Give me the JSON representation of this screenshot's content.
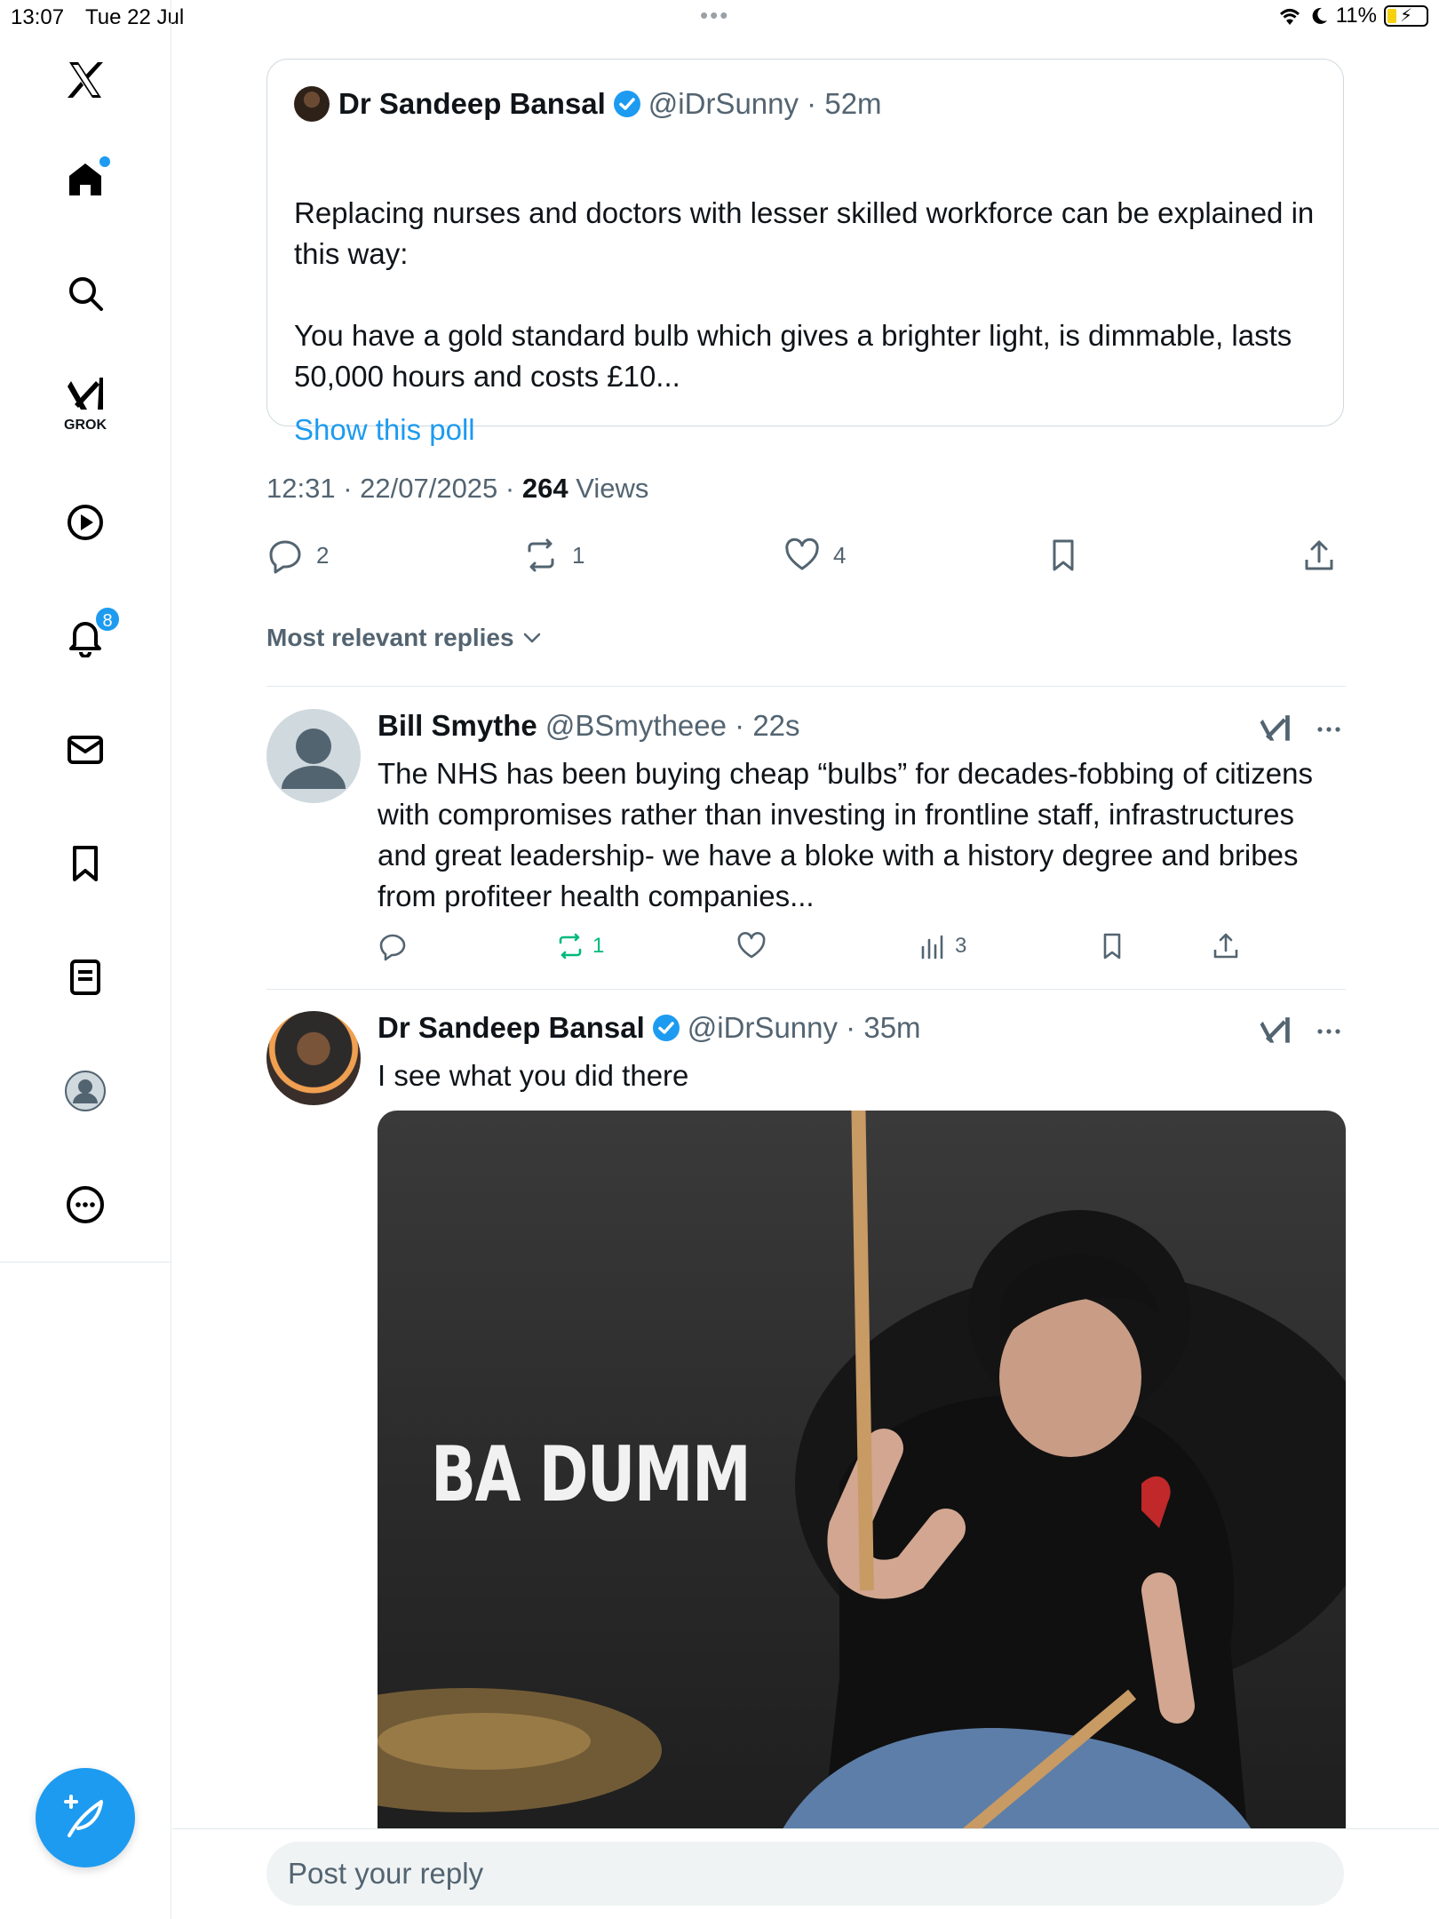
{
  "status": {
    "time": "13:07",
    "date": "Tue 22 Jul",
    "battery": "11%"
  },
  "nav": {
    "grok_label": "GROK",
    "notifications_count": "8"
  },
  "quoted": {
    "name": "Dr Sandeep Bansal",
    "handle": "@iDrSunny",
    "time": "52m",
    "para1": "Replacing nurses and doctors with lesser skilled workforce can be explained in this way:",
    "para2": "You have a gold standard bulb which gives a brighter light, is dimmable, lasts 50,000 hours and costs £10...",
    "link": "Show this poll"
  },
  "meta": {
    "time": "12:31",
    "date": "22/07/2025",
    "views": "264",
    "views_label": "Views"
  },
  "actions": {
    "replies": "2",
    "reposts": "1",
    "likes": "4"
  },
  "sort_label": "Most relevant replies",
  "replies": [
    {
      "name": "Bill Smythe",
      "handle": "@BSmytheee",
      "time": "22s",
      "text": "The NHS has been buying cheap “bulbs” for decades-fobbing of citizens with compromises rather than investing in frontline staff, infrastructures and great leadership- we have a bloke with a history degree and bribes from profiteer health companies...",
      "reposts": "1",
      "views": "3"
    },
    {
      "name": "Dr Sandeep Bansal",
      "handle": "@iDrSunny",
      "time": "35m",
      "text": "I see what you did there",
      "media_overlay": "BA DUMM"
    }
  ],
  "reply_box": {
    "placeholder": "Post your reply"
  },
  "colors": {
    "accent": "#1d9bf0",
    "repost_active": "#00ba7c",
    "muted": "#536471"
  }
}
